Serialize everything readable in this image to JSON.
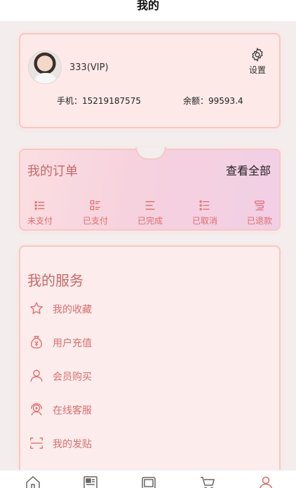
{
  "header": {
    "title": "我的"
  },
  "profile": {
    "username": "333(VIP)",
    "phone_label": "手机：",
    "phone": "15219187575",
    "balance_label": "余额：",
    "balance": "99593.4",
    "settings_label": "设置",
    "settings_icon": "gear-icon"
  },
  "orders": {
    "title": "我的订单",
    "view_all": "查看全部",
    "items": [
      {
        "label": "未支付",
        "icon": "list-icon"
      },
      {
        "label": "已支付",
        "icon": "grid-list-icon"
      },
      {
        "label": "已完成",
        "icon": "lines-icon"
      },
      {
        "label": "已取消",
        "icon": "checklist-icon"
      },
      {
        "label": "已退款",
        "icon": "refund-icon"
      }
    ]
  },
  "services": {
    "title": "我的服务",
    "items": [
      {
        "label": "我的收藏",
        "icon": "star-icon"
      },
      {
        "label": "用户充值",
        "icon": "money-bag-icon"
      },
      {
        "label": "会员购买",
        "icon": "user-icon"
      },
      {
        "label": "在线客服",
        "icon": "headset-icon"
      },
      {
        "label": "我的发贴",
        "icon": "scan-frame-icon"
      }
    ]
  },
  "tabbar": {
    "items": [
      {
        "icon": "home-icon",
        "active": false
      },
      {
        "icon": "news-icon",
        "active": false
      },
      {
        "icon": "message-icon",
        "active": false
      },
      {
        "icon": "cart-icon",
        "active": false
      },
      {
        "icon": "profile-icon",
        "active": true
      }
    ]
  },
  "colors": {
    "accent": "#e06c6c",
    "title_red": "#c46a6a",
    "card_bg": "#fdecec",
    "background": "#f3eded"
  }
}
